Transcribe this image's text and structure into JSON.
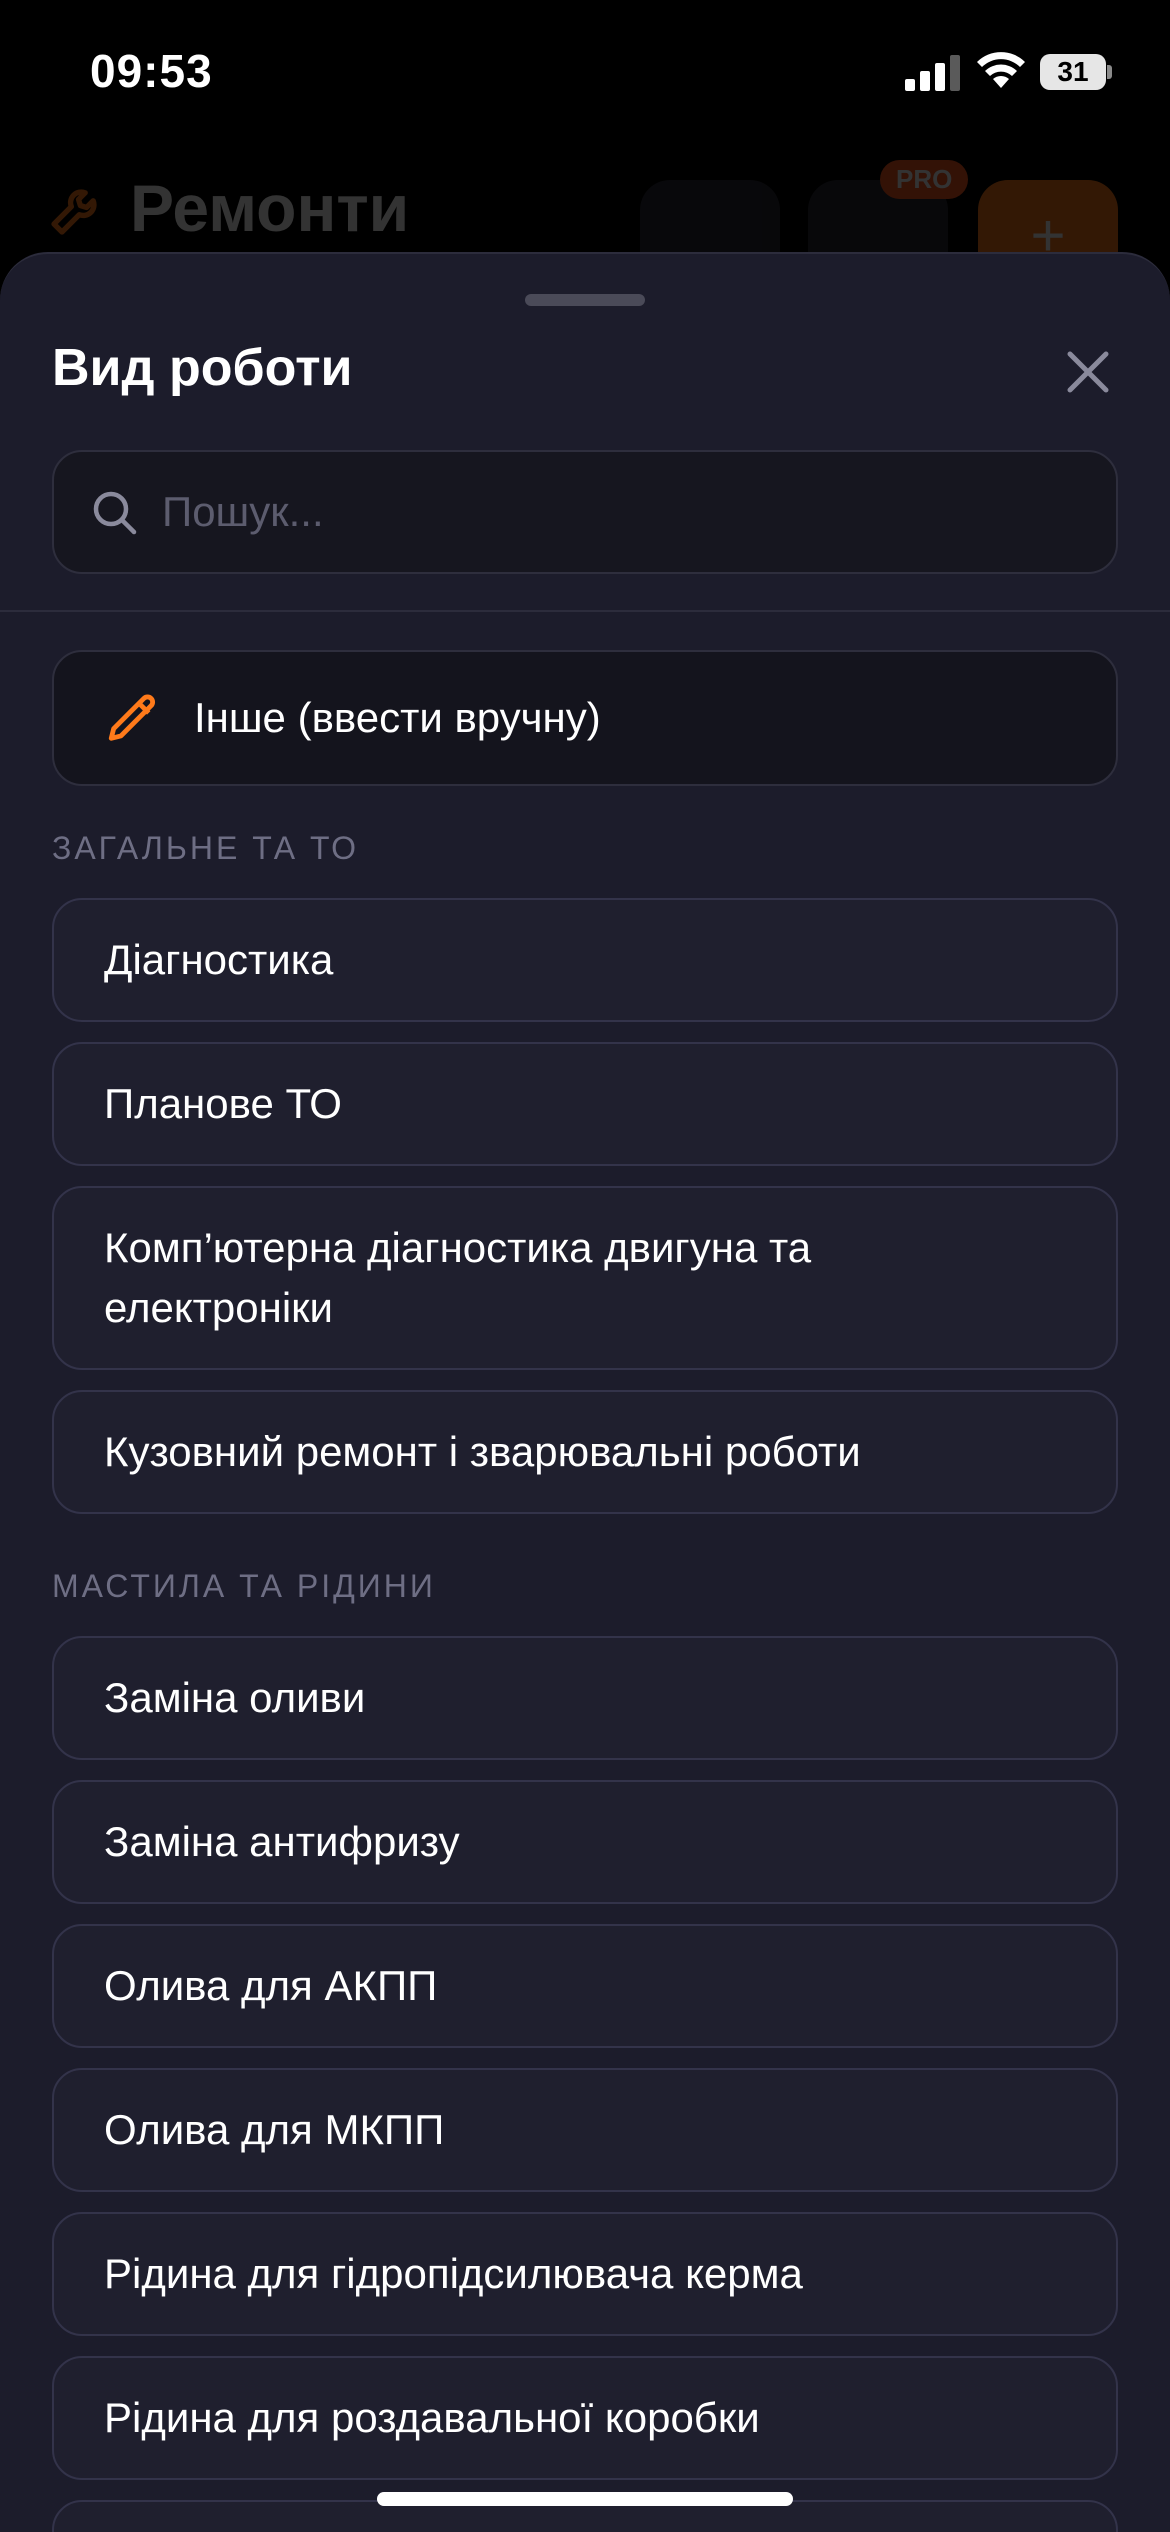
{
  "status_bar": {
    "time": "09:53",
    "battery": "31"
  },
  "background": {
    "title": "Ремонти",
    "pro_badge": "PRO",
    "add_icon": "+"
  },
  "sheet": {
    "title": "Вид роботи",
    "search_placeholder": "Пошук...",
    "other_option": "Інше (ввести вручну)",
    "sections": [
      {
        "header": "ЗАГАЛЬНЕ ТА ТО",
        "items": [
          "Діагностика",
          "Планове ТО",
          "Комп’ютерна діагностика двигуна та електроніки",
          "Кузовний ремонт і зварювальні роботи"
        ]
      },
      {
        "header": "МАСТИЛА ТА РІДИНИ",
        "items": [
          "Заміна оливи",
          "Заміна антифризу",
          "Олива для АКПП",
          "Олива для МКПП",
          "Рідина для гідропідсилювача керма",
          "Рідина для роздавальної коробки"
        ]
      }
    ]
  },
  "icons": {
    "close": "close-icon",
    "search": "search-icon",
    "pencil": "pencil-icon",
    "wrench": "wrench-icon"
  },
  "colors": {
    "accent": "#ff7a1a",
    "sheet_bg": "#1c1c2b"
  }
}
